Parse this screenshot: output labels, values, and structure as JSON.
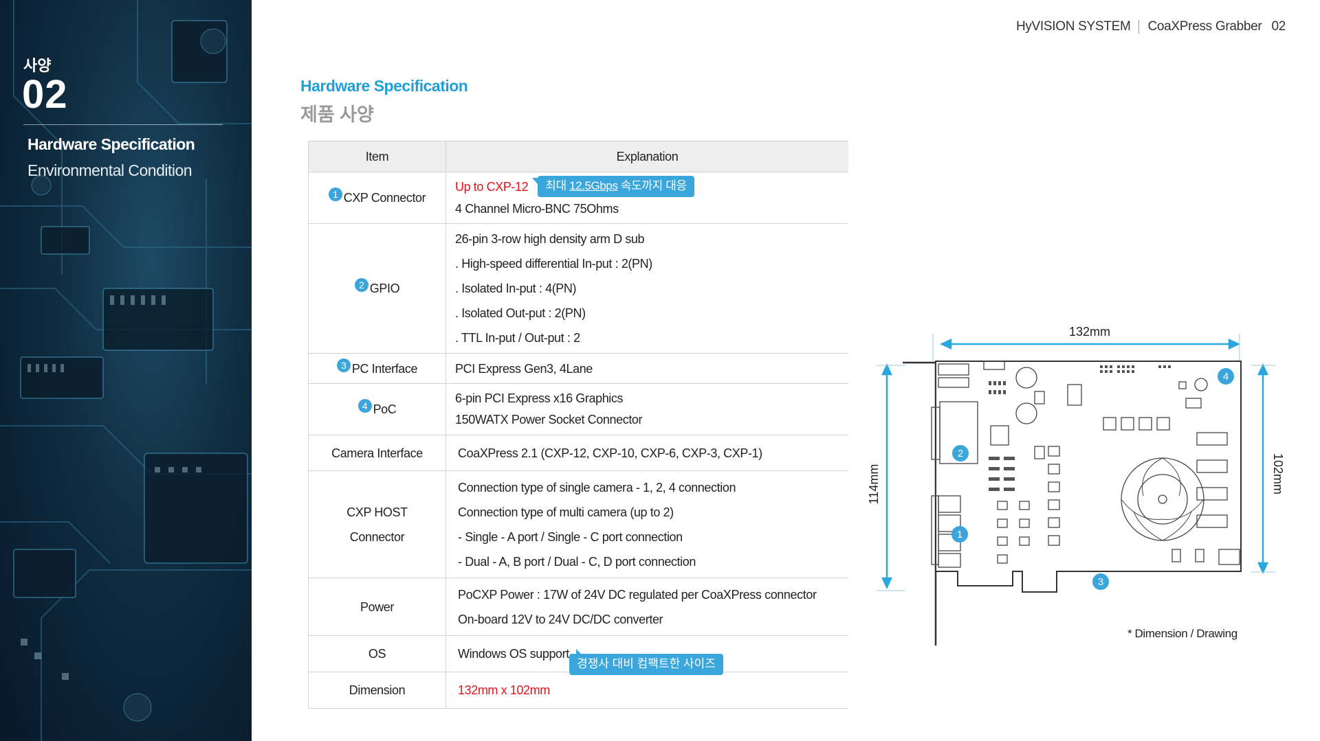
{
  "header": {
    "brand": "HyVISION SYSTEM",
    "product": "CoaXPress Grabber",
    "page_number": "02"
  },
  "sidebar": {
    "section_kr": "사양",
    "section_number": "02",
    "items": [
      {
        "label": "Hardware Specification",
        "active": true
      },
      {
        "label": "Environmental Condition",
        "active": false
      }
    ]
  },
  "title": {
    "en": "Hardware Specification",
    "kr": "제품 사양"
  },
  "table": {
    "headers": [
      "Item",
      "Explanation"
    ],
    "rows": [
      {
        "badge": "1",
        "item": "CXP Connector",
        "lines": [
          "Up to CXP-12",
          "4 Channel Micro-BNC 75Ohms"
        ],
        "callout": {
          "prefix": "최대 ",
          "underlined": "12.5Gbps",
          "suffix": " 속도까지 대응"
        }
      },
      {
        "badge": "2",
        "item": "GPIO",
        "lines": [
          "26-pin 3-row high density arm D sub",
          ". High-speed differential In-put : 2(PN)",
          ". Isolated In-put : 4(PN)",
          ". Isolated Out-put : 2(PN)",
          ". TTL In-put / Out-put : 2"
        ]
      },
      {
        "badge": "3",
        "item": "PC Interface",
        "lines": [
          "PCI Express Gen3, 4Lane"
        ]
      },
      {
        "badge": "4",
        "item": "PoC",
        "lines": [
          "6-pin PCI Express x16 Graphics",
          "150WATX Power Socket Connector"
        ]
      },
      {
        "item": "Camera Interface",
        "lines": [
          "CoaXPress 2.1 (CXP-12, CXP-10, CXP-6, CXP-3, CXP-1)"
        ]
      },
      {
        "item_lines": [
          "CXP HOST",
          "Connector"
        ],
        "lines": [
          "Connection type of single camera - 1, 2, 4 connection",
          "Connection type of multi camera (up to 2)",
          "- Single - A port / Single - C port connection",
          "- Dual - A, B port / Dual - C, D port connection"
        ]
      },
      {
        "item": "Power",
        "lines": [
          "PoCXP Power : 17W of 24V DC regulated per CoaXPress connector",
          "On-board 12V to 24V DC/DC converter"
        ]
      },
      {
        "item": "OS",
        "lines": [
          "Windows OS support"
        ]
      },
      {
        "item": "Dimension",
        "lines": [
          "132mm x 102mm"
        ]
      }
    ],
    "os_callout": "경쟁사 대비 컴팩트한 사이즈"
  },
  "drawing": {
    "width_label": "132mm",
    "height_label": "114mm",
    "board_height_label": "102mm",
    "markers": [
      "1",
      "2",
      "3",
      "4"
    ],
    "note": "* Dimension / Drawing"
  },
  "colors": {
    "accent": "#1ea0d8",
    "badge": "#3aa6dc",
    "highlight": "#e2141b",
    "sidebar_bg": "#0f2c40"
  }
}
